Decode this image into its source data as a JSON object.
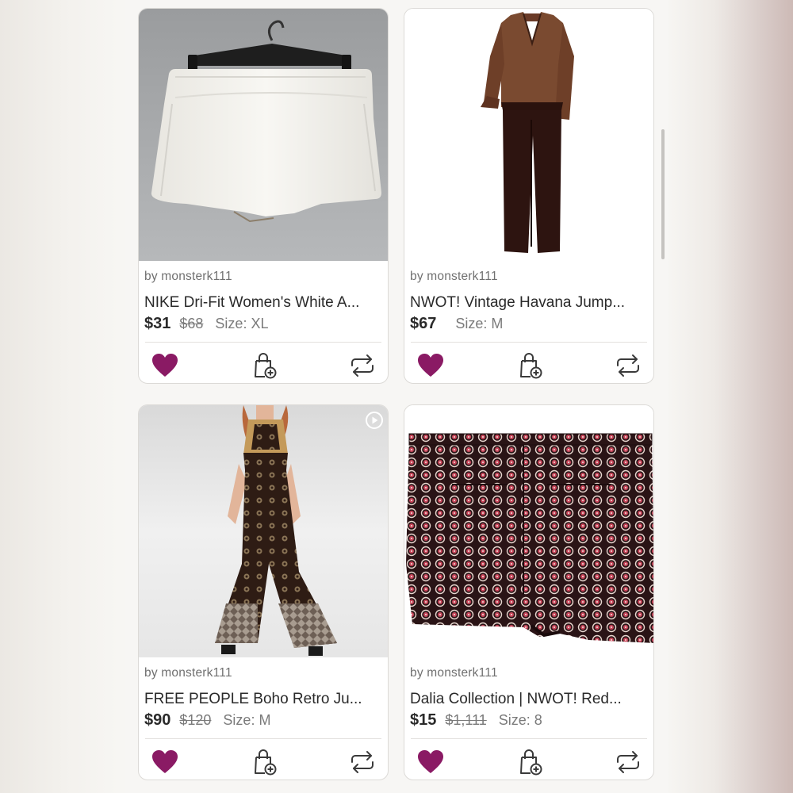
{
  "colors": {
    "like": "#8a1a64",
    "icon_stroke": "#3a3a3a",
    "page_bg": "#f7f6f4",
    "card_bg": "#ffffff"
  },
  "listings": [
    {
      "seller": "by monsterk111",
      "title": "NIKE Dri-Fit Women's White A...",
      "price": "$31",
      "original_price": "$68",
      "size_label": "Size:",
      "size": "XL",
      "liked": true,
      "image": "white-shorts-on-hanger"
    },
    {
      "seller": "by monsterk111",
      "title": "NWOT! Vintage Havana Jump...",
      "price": "$67",
      "original_price": "",
      "size_label": "Size:",
      "size": "M",
      "liked": true,
      "image": "brown-wrap-jumpsuit"
    },
    {
      "seller": "by monsterk111",
      "title": "FREE PEOPLE Boho Retro Ju...",
      "price": "$90",
      "original_price": "$120",
      "size_label": "Size:",
      "size": "M",
      "liked": true,
      "has_video": true,
      "image": "boho-print-jumpsuit-model"
    },
    {
      "seller": "by monsterk111",
      "title": "Dalia Collection | NWOT! Red...",
      "price": "$15",
      "original_price": "$1,111",
      "size_label": "Size:",
      "size": "8",
      "liked": true,
      "image": "red-geometric-print-shorts"
    }
  ],
  "icons": {
    "like": "heart-icon",
    "bundle": "shopping-bag-plus-icon",
    "share": "share-repeat-icon",
    "video": "play-icon"
  }
}
